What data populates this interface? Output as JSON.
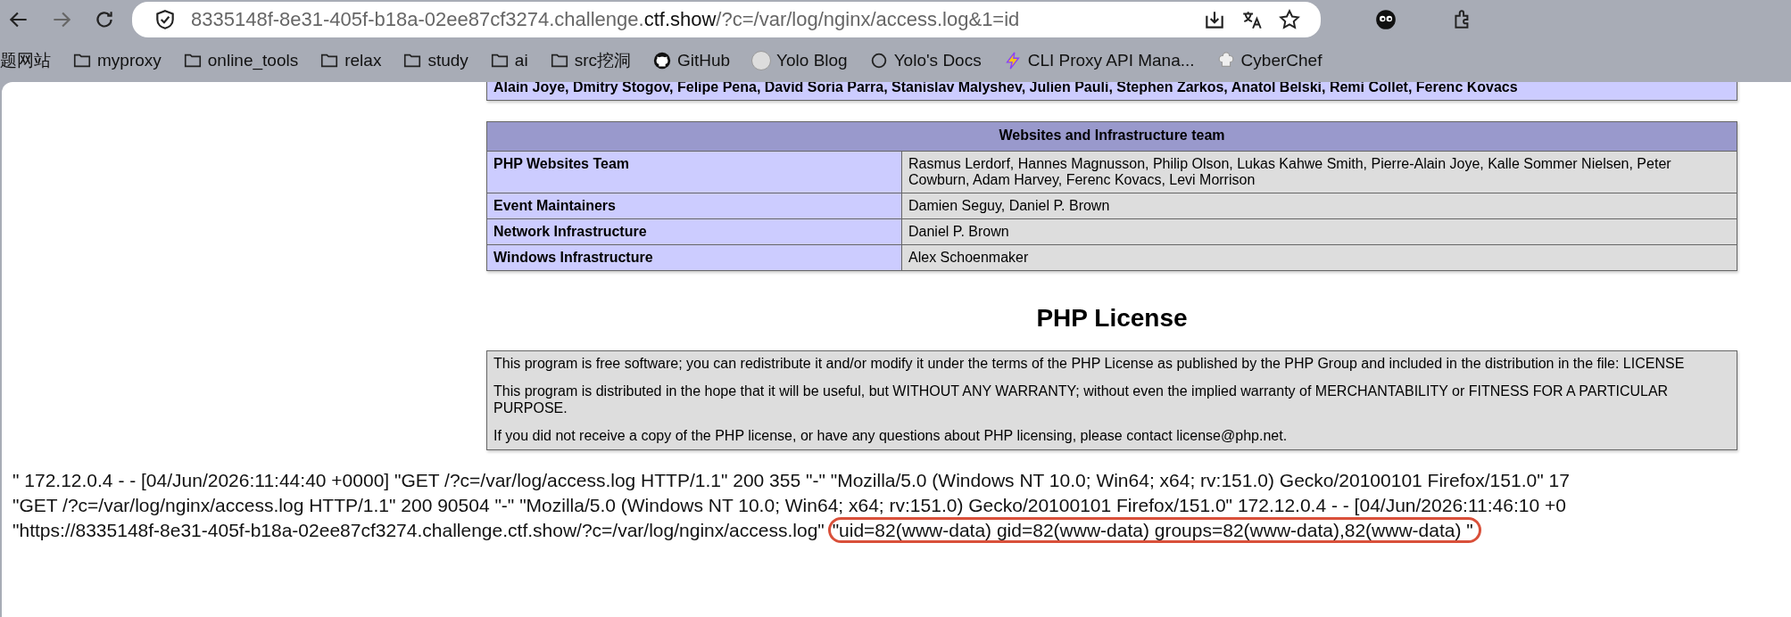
{
  "browser": {
    "url": {
      "host": "8335148f-8e31-405f-b18a-02ee87cf3274.challenge.",
      "domain": "ctf.show",
      "path": "/?c=/var/log/nginx/access.log&1=id"
    },
    "bookmarks": [
      {
        "kind": "text",
        "label": "题网站"
      },
      {
        "kind": "folder",
        "label": "myproxy"
      },
      {
        "kind": "folder",
        "label": "online_tools"
      },
      {
        "kind": "folder",
        "label": "relax"
      },
      {
        "kind": "folder",
        "label": "study"
      },
      {
        "kind": "folder",
        "label": "ai"
      },
      {
        "kind": "folder",
        "label": "src挖洞"
      },
      {
        "kind": "github",
        "label": "GitHub"
      },
      {
        "kind": "avatar",
        "label": "Yolo Blog"
      },
      {
        "kind": "circle",
        "label": "Yolo's Docs"
      },
      {
        "kind": "bolt",
        "label": "CLI Proxy API Mana..."
      },
      {
        "kind": "chef",
        "label": "CyberChef"
      }
    ]
  },
  "credits_row": {
    "cell": "Alain Joye, Dmitry Stogov, Felipe Pena, David Soria Parra, Stanislav Malyshev, Julien Pauli, Stephen Zarkos, Anatol Belski, Remi Collet, Ferenc Kovacs"
  },
  "team_table": {
    "title": "Websites and Infrastructure team",
    "rows": [
      {
        "role": "PHP Websites Team",
        "names": "Rasmus Lerdorf, Hannes Magnusson, Philip Olson, Lukas Kahwe Smith, Pierre-Alain Joye, Kalle Sommer Nielsen, Peter Cowburn, Adam Harvey, Ferenc Kovacs, Levi Morrison"
      },
      {
        "role": "Event Maintainers",
        "names": "Damien Seguy, Daniel P. Brown"
      },
      {
        "role": "Network Infrastructure",
        "names": "Daniel P. Brown"
      },
      {
        "role": "Windows Infrastructure",
        "names": "Alex Schoenmaker"
      }
    ]
  },
  "license": {
    "heading": "PHP License",
    "paragraphs": [
      "This program is free software; you can redistribute it and/or modify it under the terms of the PHP License as published by the PHP Group and included in the distribution in the file: LICENSE",
      "This program is distributed in the hope that it will be useful, but WITHOUT ANY WARRANTY; without even the implied warranty of MERCHANTABILITY or FITNESS FOR A PARTICULAR PURPOSE.",
      "If you did not receive a copy of the PHP license, or have any questions about PHP licensing, please contact license@php.net."
    ]
  },
  "log": {
    "lines": [
      "\" 172.12.0.4 - - [04/Jun/2026:11:44:40 +0000] \"GET /?c=/var/log/access.log HTTP/1.1\" 200 355 \"-\" \"Mozilla/5.0 (Windows NT 10.0; Win64; x64; rv:151.0) Gecko/20100101 Firefox/151.0\" 17",
      "\"GET /?c=/var/log/nginx/access.log HTTP/1.1\" 200 90504 \"-\" \"Mozilla/5.0 (Windows NT 10.0; Win64; x64; rv:151.0) Gecko/20100101 Firefox/151.0\" 172.12.0.4 - - [04/Jun/2026:11:46:10 +0"
    ],
    "last_line": "\"https://8335148f-8e31-405f-b18a-02ee87cf3274.challenge.ctf.show/?c=/var/log/nginx/access.log\"",
    "command_output": "\"uid=82(www-data) gid=82(www-data) groups=82(www-data),82(www-data) \""
  }
}
